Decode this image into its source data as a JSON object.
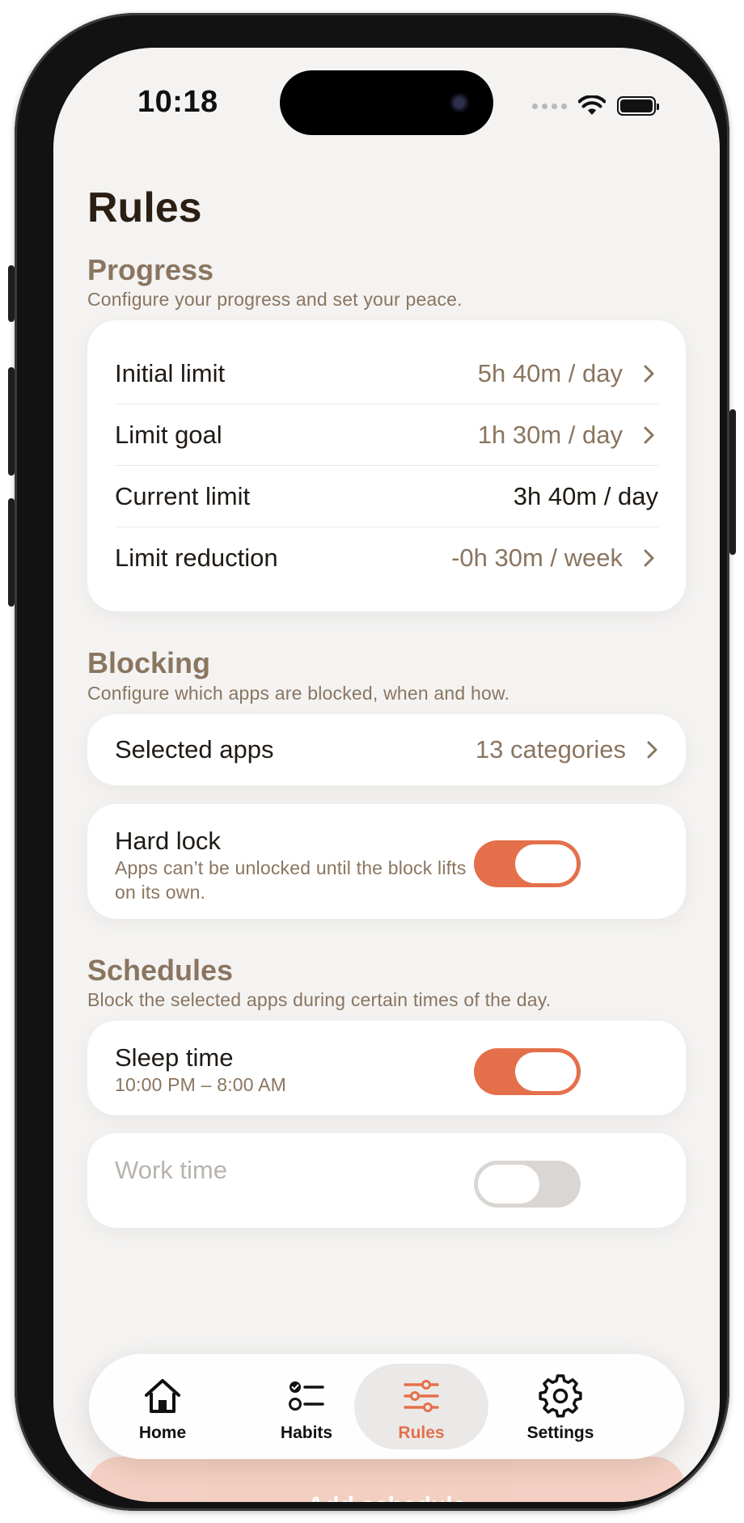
{
  "status_bar": {
    "time": "10:18"
  },
  "page": {
    "title": "Rules"
  },
  "progress": {
    "title": "Progress",
    "subtitle": "Configure your progress and set your peace.",
    "rows": [
      {
        "label": "Initial limit",
        "value": "5h 40m / day"
      },
      {
        "label": "Limit goal",
        "value": "1h 30m / day"
      },
      {
        "label": "Current limit",
        "value": "3h 40m / day"
      },
      {
        "label": "Limit reduction",
        "value": "-0h 30m / week"
      }
    ]
  },
  "blocking": {
    "title": "Blocking",
    "subtitle": "Configure which apps are blocked, when and how.",
    "selected_apps": {
      "label": "Selected apps",
      "value": "13 categories"
    },
    "hard_lock": {
      "title": "Hard lock",
      "description": "Apps can’t be unlocked until the block lifts on its own.",
      "enabled": true
    }
  },
  "schedules": {
    "title": "Schedules",
    "subtitle": "Block the selected apps during certain times of the day.",
    "items": [
      {
        "title": "Sleep time",
        "time": "10:00 PM – 8:00 AM",
        "enabled": true
      },
      {
        "title": "Work time",
        "enabled": false
      }
    ],
    "add_label": "Add schedule"
  },
  "tabbar": {
    "tabs": [
      {
        "label": "Home",
        "icon": "home-icon"
      },
      {
        "label": "Habits",
        "icon": "habits-list-icon"
      },
      {
        "label": "Rules",
        "icon": "sliders-icon",
        "active": true
      },
      {
        "label": "Settings",
        "icon": "gear-icon"
      }
    ]
  },
  "colors": {
    "accent": "#e4704b",
    "section": "#8a7560",
    "title": "#2b1f14",
    "background": "#f4f3f2"
  }
}
